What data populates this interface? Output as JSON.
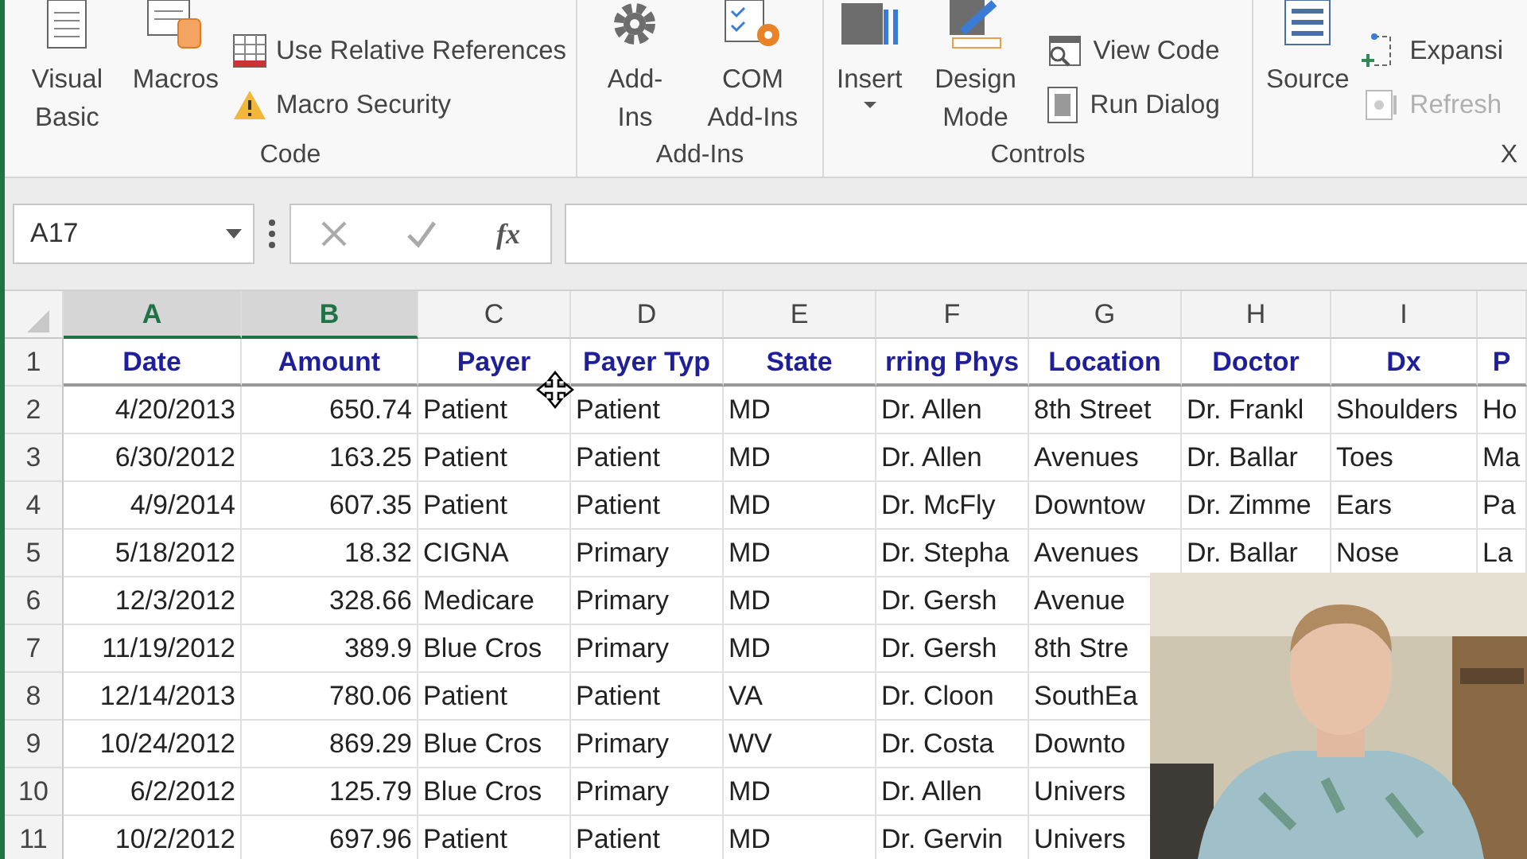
{
  "ribbon": {
    "groups": [
      {
        "label": "Code",
        "buttons": [
          {
            "kind": "large",
            "label": "Visual Basic",
            "disabled": false,
            "has_menu": false
          },
          {
            "kind": "large",
            "label": "Macros",
            "disabled": false,
            "has_menu": false
          },
          {
            "kind": "small",
            "label": "Use Relative References",
            "disabled": false,
            "has_menu": false
          },
          {
            "kind": "small",
            "label": "Macro Security",
            "disabled": false,
            "has_menu": false
          }
        ]
      },
      {
        "label": "Add-Ins",
        "buttons": [
          {
            "kind": "large",
            "label": "Add-Ins",
            "disabled": false,
            "has_menu": false
          },
          {
            "kind": "large",
            "label": "COM Add-Ins",
            "disabled": false,
            "has_menu": false
          }
        ]
      },
      {
        "label": "Controls",
        "buttons": [
          {
            "kind": "large",
            "label": "Insert",
            "disabled": false,
            "has_menu": true
          },
          {
            "kind": "large",
            "label": "Design Mode",
            "disabled": false,
            "has_menu": false
          },
          {
            "kind": "small",
            "label": "View Code",
            "disabled": false,
            "has_menu": false
          },
          {
            "kind": "small",
            "label": "Run Dialog",
            "disabled": false,
            "has_menu": false
          }
        ]
      },
      {
        "label": "X",
        "buttons": [
          {
            "kind": "large",
            "label": "Source",
            "disabled": false,
            "has_menu": false
          },
          {
            "kind": "small",
            "label": "Expansi",
            "disabled": false,
            "has_menu": false
          },
          {
            "kind": "small",
            "label": "Refresh",
            "disabled": true,
            "has_menu": false
          }
        ]
      }
    ]
  },
  "formula_bar": {
    "name_box": "A17",
    "fx": "fx"
  },
  "columns": [
    {
      "letter": "A",
      "selected": true,
      "right_aligned": true
    },
    {
      "letter": "B",
      "selected": true,
      "right_aligned": true
    },
    {
      "letter": "C",
      "selected": false,
      "right_aligned": false
    },
    {
      "letter": "D",
      "selected": false,
      "right_aligned": false
    },
    {
      "letter": "E",
      "selected": false,
      "right_aligned": false
    },
    {
      "letter": "F",
      "selected": false,
      "right_aligned": false
    },
    {
      "letter": "G",
      "selected": false,
      "right_aligned": false
    },
    {
      "letter": "H",
      "selected": false,
      "right_aligned": false
    },
    {
      "letter": "I",
      "selected": false,
      "right_aligned": false
    },
    {
      "selected": false,
      "right_aligned": false
    }
  ],
  "header_row": {
    "number": "1",
    "cells": [
      "Date",
      "Amount",
      "Payer",
      "Payer Typ",
      "State",
      "rring Phys",
      "Location",
      "Doctor",
      "Dx",
      "P"
    ]
  },
  "rows": [
    {
      "number": "2",
      "cells": [
        "4/20/2013",
        "650.74",
        "Patient",
        "Patient",
        "MD",
        "Dr. Allen",
        "8th Street",
        "Dr. Frankl",
        "Shoulders",
        "Ho"
      ]
    },
    {
      "number": "3",
      "cells": [
        "6/30/2012",
        "163.25",
        "Patient",
        "Patient",
        "MD",
        "Dr. Allen",
        "Avenues",
        "Dr. Ballar",
        "Toes",
        "Ma"
      ]
    },
    {
      "number": "4",
      "cells": [
        "4/9/2014",
        "607.35",
        "Patient",
        "Patient",
        "MD",
        "Dr. McFly",
        "Downtow",
        "Dr. Zimme",
        "Ears",
        "Pa"
      ]
    },
    {
      "number": "5",
      "cells": [
        "5/18/2012",
        "18.32",
        "CIGNA",
        "Primary",
        "MD",
        "Dr. Stepha",
        "Avenues",
        "Dr. Ballar",
        "Nose",
        "La"
      ]
    },
    {
      "number": "6",
      "cells": [
        "12/3/2012",
        "328.66",
        "Medicare",
        "Primary",
        "MD",
        "Dr. Gersh",
        "Avenue"
      ]
    },
    {
      "number": "7",
      "cells": [
        "11/19/2012",
        "389.9",
        "Blue Cros",
        "Primary",
        "MD",
        "Dr. Gersh",
        "8th Stre"
      ]
    },
    {
      "number": "8",
      "cells": [
        "12/14/2013",
        "780.06",
        "Patient",
        "Patient",
        "VA",
        "Dr. Cloon",
        "SouthEa"
      ]
    },
    {
      "number": "9",
      "cells": [
        "10/24/2012",
        "869.29",
        "Blue Cros",
        "Primary",
        "WV",
        "Dr. Costa",
        "Downto"
      ]
    },
    {
      "number": "10",
      "cells": [
        "6/2/2012",
        "125.79",
        "Blue Cros",
        "Primary",
        "MD",
        "Dr. Allen",
        "Univers"
      ]
    },
    {
      "number": "11",
      "cells": [
        "10/2/2012",
        "697.96",
        "Patient",
        "Patient",
        "MD",
        "Dr. Gervin",
        "Univers"
      ]
    }
  ]
}
